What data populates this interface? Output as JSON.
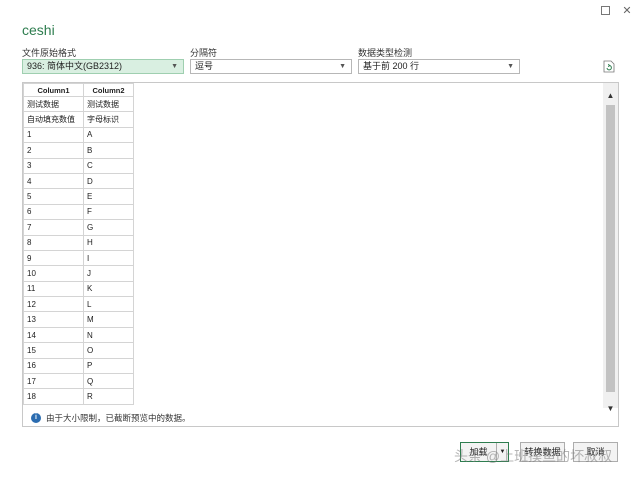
{
  "window": {
    "title": "ceshi",
    "maximize_icon": "maximize-icon",
    "close_label": "✕"
  },
  "options": {
    "encoding": {
      "label": "文件原始格式",
      "value": "936: 简体中文(GB2312)"
    },
    "delimiter": {
      "label": "分隔符",
      "value": "逗号"
    },
    "type_detection": {
      "label": "数据类型检测",
      "value": "基于前 200 行"
    }
  },
  "table": {
    "headers": [
      "Column1",
      "Column2"
    ],
    "rows": [
      [
        "测试数据",
        "测试数据"
      ],
      [
        "自动填充数值",
        "字母标识"
      ],
      [
        "1",
        "A"
      ],
      [
        "2",
        "B"
      ],
      [
        "3",
        "C"
      ],
      [
        "4",
        "D"
      ],
      [
        "5",
        "E"
      ],
      [
        "6",
        "F"
      ],
      [
        "7",
        "G"
      ],
      [
        "8",
        "H"
      ],
      [
        "9",
        "I"
      ],
      [
        "10",
        "J"
      ],
      [
        "11",
        "K"
      ],
      [
        "12",
        "L"
      ],
      [
        "13",
        "M"
      ],
      [
        "14",
        "N"
      ],
      [
        "15",
        "O"
      ],
      [
        "16",
        "P"
      ],
      [
        "17",
        "Q"
      ],
      [
        "18",
        "R"
      ]
    ]
  },
  "notice": "由于大小限制，已截断预览中的数据。",
  "buttons": {
    "load": "加载",
    "convert": "转换数据",
    "cancel": "取消"
  },
  "watermark": "头条 @上班摸鱼的坏叔叔",
  "colors": {
    "accent": "#2e7d4f",
    "selected_bg": "#d9efe1",
    "info": "#2b6cb0"
  }
}
